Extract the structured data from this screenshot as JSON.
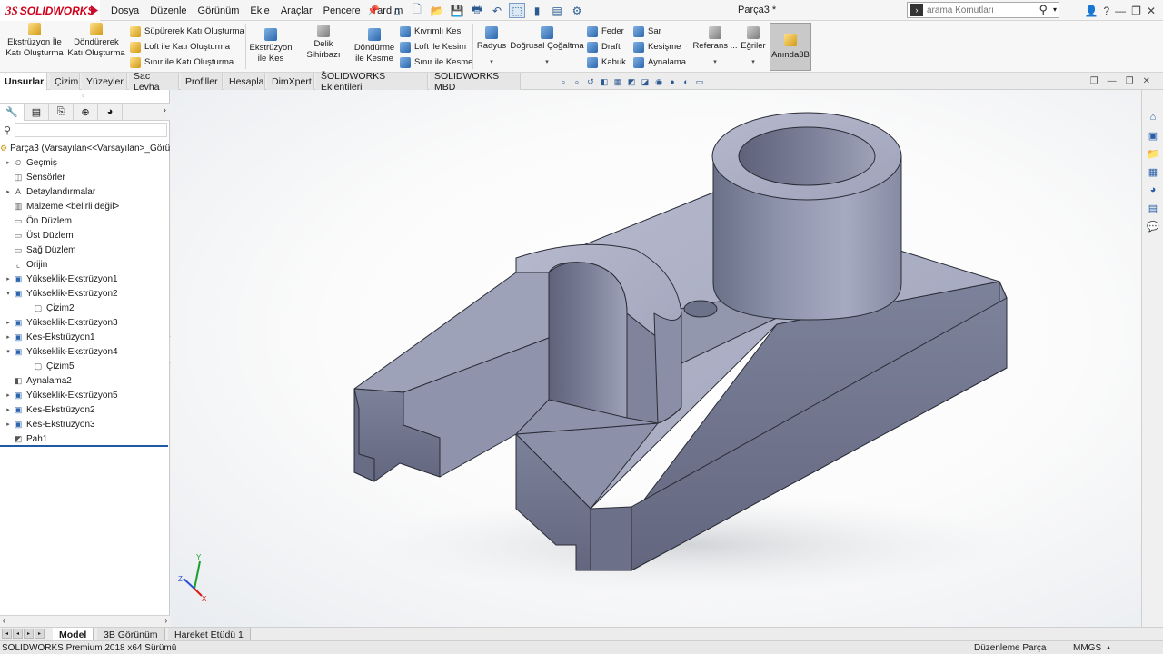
{
  "app": {
    "logo_prefix": "3S",
    "logo_name": "SOLIDWORKS",
    "menu": [
      "Dosya",
      "Düzenle",
      "Görünüm",
      "Ekle",
      "Araçlar",
      "Pencere",
      "Yardım"
    ],
    "doc_title": "Parça3 *",
    "search_placeholder": "arama Komutları"
  },
  "ribbon": {
    "extrude_boss_1": "Ekstrüzyon İle",
    "extrude_boss_2": "Katı Oluşturma",
    "revolve_boss_1": "Döndürerek",
    "revolve_boss_2": "Katı Oluşturma",
    "sweep_boss": "Süpürerek Katı Oluşturma",
    "loft_boss": "Loft ile Katı Oluşturma",
    "boundary_boss": "Sınır ile Katı Oluşturma",
    "extrude_cut_1": "Ekstrüzyon",
    "extrude_cut_2": "ile Kes",
    "hole_wizard": "Delik Sihirbazı",
    "revolve_cut_1": "Döndürme",
    "revolve_cut_2": "ile Kesme",
    "swept_cut": "Kıvrımlı Kes.",
    "lofted_cut": "Loft ile Kesim",
    "boundary_cut": "Sınır ile Kesme",
    "fillet": "Radyus",
    "linear_pattern": "Doğrusal Çoğaltma",
    "rib": "Feder",
    "draft": "Draft",
    "shell": "Kabuk",
    "wrap": "Sar",
    "intersect": "Kesişme",
    "mirror": "Aynalama",
    "reference": "Referans ...",
    "curves": "Eğriler",
    "instant3d": "Anında3B"
  },
  "tabs": [
    "Unsurlar",
    "Çizim",
    "Yüzeyler",
    "Sac Levha",
    "Profiller",
    "Hesapla",
    "DimXpert",
    "SOLIDWORKS Eklentileri",
    "SOLIDWORKS MBD"
  ],
  "tree": [
    {
      "label": "Parça3  (Varsayılan<<Varsayılan>_Görü",
      "icon": "part-icon",
      "exp": "",
      "indent": 0
    },
    {
      "label": "Geçmiş",
      "icon": "history-icon",
      "exp": "▸",
      "indent": 1
    },
    {
      "label": "Sensörler",
      "icon": "sensor-icon",
      "exp": "",
      "indent": 1
    },
    {
      "label": "Detaylandırmalar",
      "icon": "annotation-icon",
      "exp": "▸",
      "indent": 1
    },
    {
      "label": "Malzeme <belirli değil>",
      "icon": "material-icon",
      "exp": "",
      "indent": 1
    },
    {
      "label": "Ön Düzlem",
      "icon": "plane-icon",
      "exp": "",
      "indent": 1
    },
    {
      "label": "Üst Düzlem",
      "icon": "plane-icon",
      "exp": "",
      "indent": 1
    },
    {
      "label": "Sağ Düzlem",
      "icon": "plane-icon",
      "exp": "",
      "indent": 1
    },
    {
      "label": "Orijin",
      "icon": "origin-icon",
      "exp": "",
      "indent": 1
    },
    {
      "label": "Yükseklik-Ekstrüzyon1",
      "icon": "extrude-icon",
      "exp": "▸",
      "indent": 1
    },
    {
      "label": "Yükseklik-Ekstrüzyon2",
      "icon": "extrude-icon",
      "exp": "▾",
      "indent": 1
    },
    {
      "label": "Çizim2",
      "icon": "sketch-icon",
      "exp": "",
      "indent": 2
    },
    {
      "label": "Yükseklik-Ekstrüzyon3",
      "icon": "extrude-icon",
      "exp": "▸",
      "indent": 1
    },
    {
      "label": "Kes-Ekstrüzyon1",
      "icon": "cut-icon",
      "exp": "▸",
      "indent": 1
    },
    {
      "label": "Yükseklik-Ekstrüzyon4",
      "icon": "extrude-icon",
      "exp": "▾",
      "indent": 1
    },
    {
      "label": "Çizim5",
      "icon": "sketch-icon",
      "exp": "",
      "indent": 2
    },
    {
      "label": "Aynalama2",
      "icon": "mirror-icon",
      "exp": "",
      "indent": 1
    },
    {
      "label": "Yükseklik-Ekstrüzyon5",
      "icon": "extrude-icon",
      "exp": "▸",
      "indent": 1
    },
    {
      "label": "Kes-Ekstrüzyon2",
      "icon": "cut-icon",
      "exp": "▸",
      "indent": 1
    },
    {
      "label": "Kes-Ekstrüzyon3",
      "icon": "cut-icon",
      "exp": "▸",
      "indent": 1
    },
    {
      "label": "Pah1",
      "icon": "chamfer-icon",
      "exp": "",
      "indent": 1
    }
  ],
  "bottom_tabs": [
    "Model",
    "3B Görünüm",
    "Hareket Etüdü 1"
  ],
  "status": {
    "version": "SOLIDWORKS Premium 2018 x64 Sürümü",
    "mode": "Düzenleme Parça",
    "units": "MMGS"
  },
  "colors": {
    "brand": "#d0021b",
    "model_face_top": "#a9adc4",
    "model_face_front": "#70758e",
    "model_face_side": "#868ba4"
  }
}
